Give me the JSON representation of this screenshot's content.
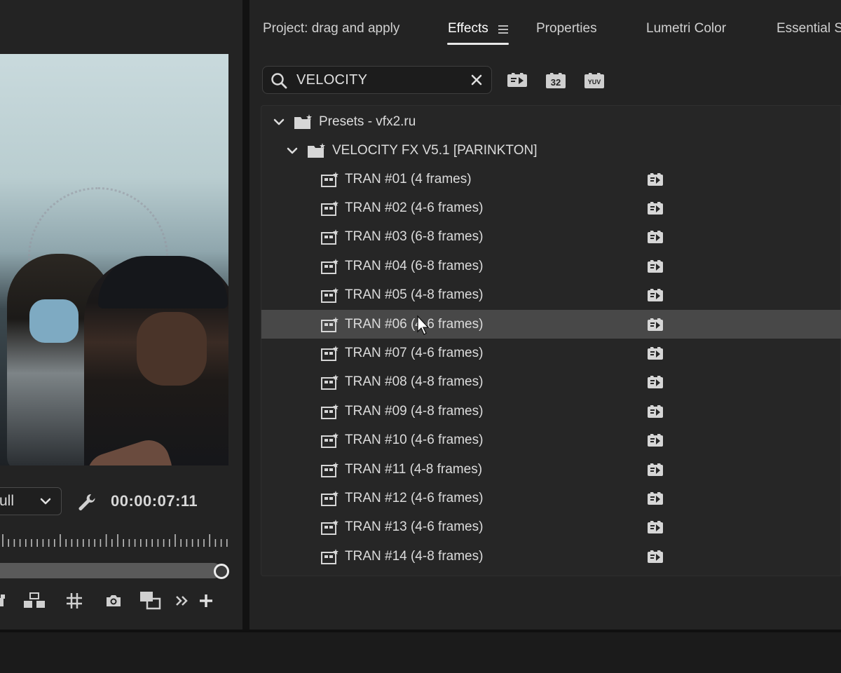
{
  "monitor": {
    "resolution": "Full",
    "resolution_visible": "ull",
    "timecode": "00:00:07:11",
    "playhead_progress": 1.0,
    "transport_icons": [
      "lift-icon",
      "extract-icon",
      "grid-icon",
      "camera-icon",
      "compare-icon",
      "more-icon",
      "add-icon"
    ]
  },
  "panel": {
    "tabs": [
      {
        "label": "Project: drag and apply",
        "active": false
      },
      {
        "label": "Effects",
        "active": true
      },
      {
        "label": "Properties",
        "active": false
      },
      {
        "label": "Lumetri Color",
        "active": false
      },
      {
        "label": "Essential Sc",
        "active": false
      }
    ],
    "search": {
      "value": "VELOCITY"
    },
    "filters": [
      {
        "name": "accelerated-effects-filter",
        "text": ""
      },
      {
        "name": "32-bit-filter",
        "text": "32"
      },
      {
        "name": "yuv-filter",
        "text": "YUV"
      }
    ],
    "tree": {
      "root": "Presets - vfx2.ru",
      "folder": "VELOCITY FX V5.1 [PARINKTON]",
      "items": [
        "TRAN #01 (4 frames)",
        "TRAN #02 (4-6 frames)",
        "TRAN #03 (6-8 frames)",
        "TRAN #04 (6-8 frames)",
        "TRAN #05 (4-8 frames)",
        "TRAN #06 (4-6 frames)",
        "TRAN #07 (4-6 frames)",
        "TRAN #08 (4-8 frames)",
        "TRAN #09 (4-8 frames)",
        "TRAN #10 (4-6 frames)",
        "TRAN #11 (4-8 frames)",
        "TRAN #12 (4-6 frames)",
        "TRAN #13 (4-6 frames)",
        "TRAN #14 (4-8 frames)"
      ],
      "selected_index": 5
    }
  },
  "colors": {
    "panel_bg": "#232323",
    "selected_row": "#484848",
    "text": "#dcdcdc"
  }
}
